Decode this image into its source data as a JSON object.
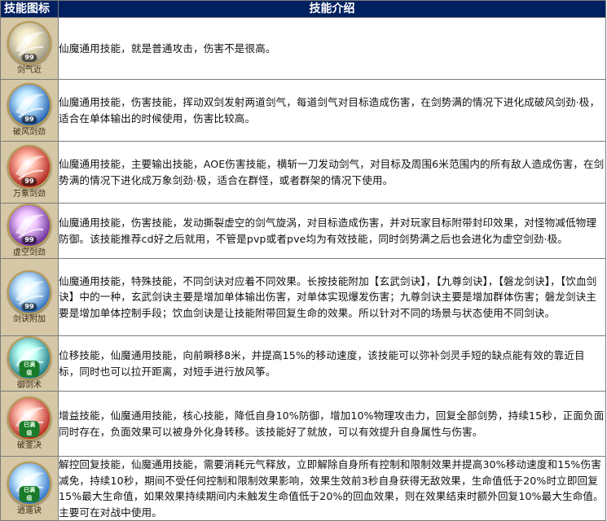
{
  "header": {
    "icon_col": "技能图标",
    "desc_col": "技能介绍"
  },
  "skills": [
    {
      "name": "剑气近",
      "badge": "99",
      "icon": "sword-slash-icon",
      "colors": [
        "#f3e9c4",
        "#8d8a7a"
      ],
      "desc": "仙魔通用技能，就是普通攻击，伤害不是很高。"
    },
    {
      "name": "破风剑劲",
      "badge": "99",
      "icon": "twin-wind-slash-icon",
      "colors": [
        "#bfe8ff",
        "#0d4fa8"
      ],
      "desc": "仙魔通用技能，伤害技能，挥动双剑发射两道剑气，每道剑气对目标造成伤害，在剑势满的情况下进化成破风剑劲·极，适合在单体输出的时候使用，伤害比较高。"
    },
    {
      "name": "万象剑劲",
      "badge": "99",
      "icon": "red-vortex-slash-icon",
      "colors": [
        "#ffb3a0",
        "#a8120f"
      ],
      "desc": "仙魔通用技能，主要输出技能，AOE伤害技能，横斩一刀发动剑气，对目标及周围6米范围内的所有敌人造成伤害，在剑势满的情况下进化成万象剑劲·极，适合在群怪，或者群架的情况下使用。"
    },
    {
      "name": "虚空剑劲",
      "badge": "99",
      "icon": "purple-void-vortex-icon",
      "colors": [
        "#f0c6ff",
        "#5a1a8f"
      ],
      "desc": "仙魔通用技能，伤害技能，发动撕裂虚空的剑气旋涡，对目标造成伤害，并对玩家目标附带封印效果，对怪物减低物理防御。该技能推荐cd好之后就用，不管是pvp或者pve均为有效技能，同时剑势满之后也会进化为虚空剑劲·极。"
    },
    {
      "name": "剑诀附加",
      "badge": "99",
      "icon": "blue-sword-burst-icon",
      "colors": [
        "#d8f4ff",
        "#1c5fb8"
      ],
      "desc": "仙魔通用技能，特殊技能，不同剑诀对应着不同效果。长按技能附加【玄武剑诀】，【九尊剑诀】，【磐龙剑诀】，【饮血剑诀】中的一种，玄武剑诀主要是增加单体输出伤害，对单体实现爆发伤害；九尊剑诀主要是增加群体伤害；磐龙剑诀主要是增加单体控制手段；饮血剑诀是让技能附带回复生命的效果。所以针对不同的场景与状态使用不同剑诀。"
    },
    {
      "name": "御剑术",
      "badge": "已满级",
      "badge_style": "green",
      "icon": "teal-dash-icon",
      "colors": [
        "#b8fff4",
        "#0b6a7a"
      ],
      "desc": "位移技能，仙魔通用技能，向前瞬移8米，并提高15%的移动速度，该技能可以弥补剑灵手短的缺点能有效的靠近目标，同时也可以拉开距离，对短手进行放风筝。"
    },
    {
      "name": "破釜决",
      "badge": "已满级",
      "badge_style": "green",
      "icon": "red-rage-icon",
      "colors": [
        "#ffc2b3",
        "#b0170f"
      ],
      "desc": "增益技能，仙魔通用技能，核心技能，降低自身10%防御，增加10%物理攻击力，回复全部剑势，持续15秒，正面负面同时存在，负面效果可以被身外化身转移。该技能好了就放，可以有效提升自身属性与伤害。"
    },
    {
      "name": "逍遥诀",
      "badge": "已满级",
      "badge_style": "green",
      "icon": "blue-release-icon",
      "colors": [
        "#d6f3ff",
        "#1a64c4"
      ],
      "desc": "解控回复技能，仙魔通用技能，需要消耗元气释放，立即解除自身所有控制和限制效果并提高30%移动速度和15%伤害减免，持续10秒，期间不受任何控制和限制效果影响，效果生效前3秒自身获得无敌效果，生命值低于20%时立即回复15%最大生命值，如果效果持续期间内未触发生命值低于20%的回血效果，则在效果结束时额外回复10%最大生命值。主要可在对战中使用。"
    }
  ]
}
